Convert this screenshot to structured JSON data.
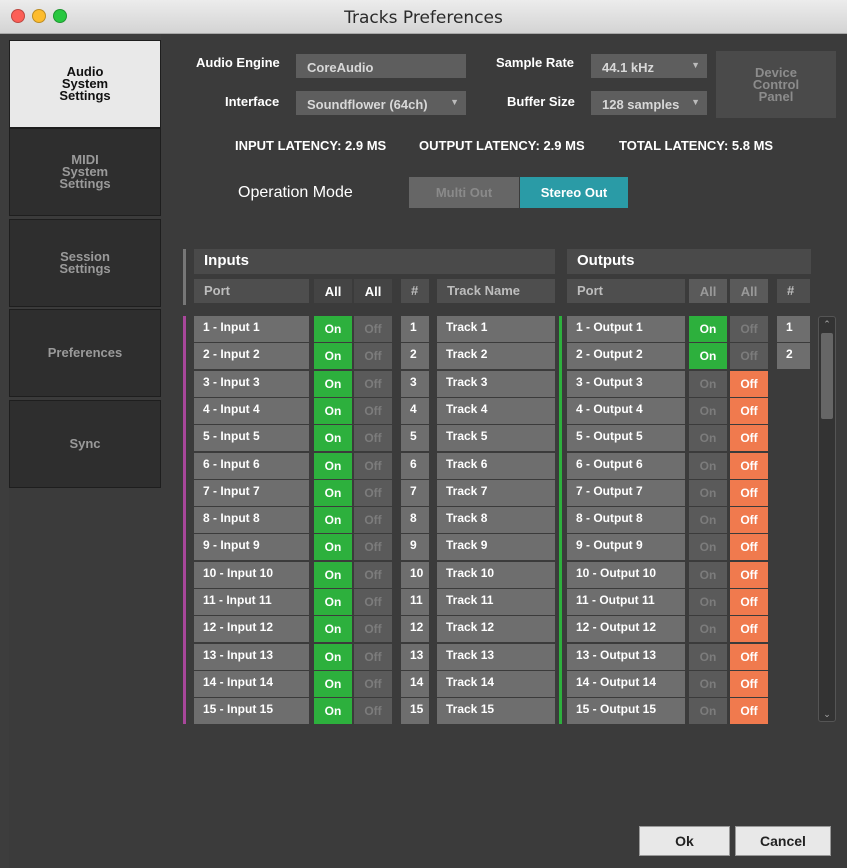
{
  "window": {
    "title": "Tracks Preferences"
  },
  "sidebar": {
    "items": [
      {
        "label": "Audio\nSystem\nSettings"
      },
      {
        "label": "MIDI\nSystem\nSettings"
      },
      {
        "label": "Session\nSettings"
      },
      {
        "label": "Preferences"
      },
      {
        "label": "Sync"
      }
    ]
  },
  "settings": {
    "audio_engine_label": "Audio Engine",
    "audio_engine_value": "CoreAudio",
    "interface_label": "Interface",
    "interface_value": "Soundflower (64ch)",
    "sample_rate_label": "Sample Rate",
    "sample_rate_value": "44.1 kHz",
    "buffer_size_label": "Buffer Size",
    "buffer_size_value": "128 samples",
    "device_panel_label": "Device\nControl\nPanel"
  },
  "latency": {
    "input": "INPUT LATENCY: 2.9 MS",
    "output": "OUTPUT LATENCY: 2.9 MS",
    "total": "TOTAL LATENCY: 5.8 MS"
  },
  "operation": {
    "label": "Operation Mode",
    "multi": "Multi Out",
    "stereo": "Stereo Out"
  },
  "inputs": {
    "title": "Inputs",
    "port_header": "Port",
    "all1": "All",
    "all2": "All",
    "num_header": "#",
    "track_header": "Track Name",
    "rows": [
      {
        "port": "1 - Input 1",
        "on": "On",
        "off": "Off",
        "num": "1",
        "track": "Track 1"
      },
      {
        "port": "2 - Input 2",
        "on": "On",
        "off": "Off",
        "num": "2",
        "track": "Track 2"
      },
      {
        "port": "3 - Input 3",
        "on": "On",
        "off": "Off",
        "num": "3",
        "track": "Track 3"
      },
      {
        "port": "4 - Input 4",
        "on": "On",
        "off": "Off",
        "num": "4",
        "track": "Track 4"
      },
      {
        "port": "5 - Input 5",
        "on": "On",
        "off": "Off",
        "num": "5",
        "track": "Track 5"
      },
      {
        "port": "6 - Input 6",
        "on": "On",
        "off": "Off",
        "num": "6",
        "track": "Track 6"
      },
      {
        "port": "7 - Input 7",
        "on": "On",
        "off": "Off",
        "num": "7",
        "track": "Track 7"
      },
      {
        "port": "8 - Input 8",
        "on": "On",
        "off": "Off",
        "num": "8",
        "track": "Track 8"
      },
      {
        "port": "9 - Input 9",
        "on": "On",
        "off": "Off",
        "num": "9",
        "track": "Track 9"
      },
      {
        "port": "10 - Input 10",
        "on": "On",
        "off": "Off",
        "num": "10",
        "track": "Track 10"
      },
      {
        "port": "11 - Input 11",
        "on": "On",
        "off": "Off",
        "num": "11",
        "track": "Track 11"
      },
      {
        "port": "12 - Input 12",
        "on": "On",
        "off": "Off",
        "num": "12",
        "track": "Track 12"
      },
      {
        "port": "13 - Input 13",
        "on": "On",
        "off": "Off",
        "num": "13",
        "track": "Track 13"
      },
      {
        "port": "14 - Input 14",
        "on": "On",
        "off": "Off",
        "num": "14",
        "track": "Track 14"
      },
      {
        "port": "15 - Input 15",
        "on": "On",
        "off": "Off",
        "num": "15",
        "track": "Track 15"
      }
    ]
  },
  "outputs": {
    "title": "Outputs",
    "port_header": "Port",
    "all1": "All",
    "all2": "All",
    "num_header": "#",
    "rows": [
      {
        "port": "1 - Output 1",
        "on": "On",
        "off": "Off",
        "active": true
      },
      {
        "port": "2 - Output 2",
        "on": "On",
        "off": "Off",
        "active": true
      },
      {
        "port": "3 - Output 3",
        "on": "On",
        "off": "Off",
        "active": false
      },
      {
        "port": "4 - Output 4",
        "on": "On",
        "off": "Off",
        "active": false
      },
      {
        "port": "5 - Output 5",
        "on": "On",
        "off": "Off",
        "active": false
      },
      {
        "port": "6 - Output 6",
        "on": "On",
        "off": "Off",
        "active": false
      },
      {
        "port": "7 - Output 7",
        "on": "On",
        "off": "Off",
        "active": false
      },
      {
        "port": "8 - Output 8",
        "on": "On",
        "off": "Off",
        "active": false
      },
      {
        "port": "9 - Output 9",
        "on": "On",
        "off": "Off",
        "active": false
      },
      {
        "port": "10 - Output 10",
        "on": "On",
        "off": "Off",
        "active": false
      },
      {
        "port": "11 - Output 11",
        "on": "On",
        "off": "Off",
        "active": false
      },
      {
        "port": "12 - Output 12",
        "on": "On",
        "off": "Off",
        "active": false
      },
      {
        "port": "13 - Output 13",
        "on": "On",
        "off": "Off",
        "active": false
      },
      {
        "port": "14 - Output 14",
        "on": "On",
        "off": "Off",
        "active": false
      },
      {
        "port": "15 - Output 15",
        "on": "On",
        "off": "Off",
        "active": false
      }
    ],
    "channels": [
      "1",
      "2"
    ]
  },
  "footer": {
    "ok": "Ok",
    "cancel": "Cancel"
  },
  "colors": {
    "on": "#2db03d",
    "off_active": "#f07a4e",
    "stereo": "#2a9ba6",
    "input_bar": "#a8479b",
    "output_bar": "#2db03d"
  },
  "icons": {
    "close": "close-icon",
    "minimize": "minimize-icon",
    "zoom": "zoom-icon",
    "dropdown": "chevron-down-icon"
  }
}
